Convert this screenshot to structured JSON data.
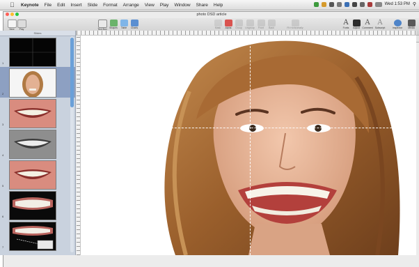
{
  "menubar": {
    "app": "Keynote",
    "items": [
      "File",
      "Edit",
      "Insert",
      "Slide",
      "Format",
      "Arrange",
      "View",
      "Play",
      "Window",
      "Share",
      "Help"
    ],
    "clock": "Wed 1:53 PM"
  },
  "window": {
    "title": "photo DSD article"
  },
  "toolbar": {
    "new_label": "New",
    "play_label": "Play",
    "textbox_label": "Text Box",
    "shapes_label": "Shapes",
    "table_label": "Table",
    "charts_label": "Charts",
    "mask_label": "Mask",
    "alpha_label": "Alpha",
    "group_label": "Group",
    "ungroup_label": "Ungroup",
    "front_label": "Front",
    "back_label": "Back",
    "fit_label": "Fit Horizontally",
    "fonts_label": "Fonts",
    "adjust_label": "Adjust",
    "comment_label": "Comment",
    "subscript_label": "Subscript",
    "inspector_label": "Inspector",
    "media_label": "Media"
  },
  "formatbar": {
    "style_label": "Styles",
    "opacity_label": "Opacity",
    "shadow_label": "Shadow",
    "reflection_label": "Reflection"
  },
  "navigator": {
    "header": "Slides",
    "slides": [
      {
        "number": "1",
        "kind": "dark"
      },
      {
        "number": "2",
        "kind": "face"
      },
      {
        "number": "3",
        "kind": "smile"
      },
      {
        "number": "4",
        "kind": "smile-gray"
      },
      {
        "number": "5",
        "kind": "smile"
      },
      {
        "number": "6",
        "kind": "teeth-dark"
      },
      {
        "number": "7",
        "kind": "teeth-annotated"
      }
    ]
  },
  "colors": {
    "selection": "#8da0c2",
    "navigator_bg": "#c9d2de",
    "guide": "#ffffff",
    "scroll_knob": "#6aa0d8"
  }
}
